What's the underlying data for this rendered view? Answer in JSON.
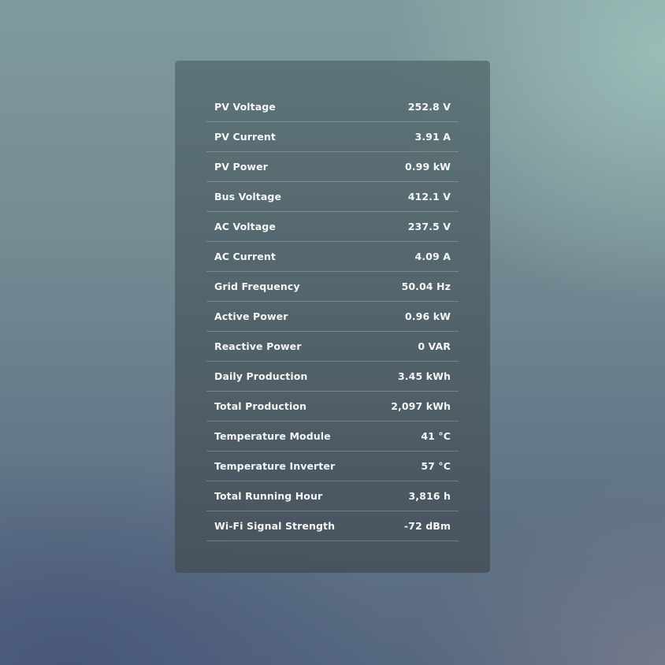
{
  "readings": [
    {
      "label": "PV Voltage",
      "value": "252.8 V"
    },
    {
      "label": "PV Current",
      "value": "3.91 A"
    },
    {
      "label": "PV Power",
      "value": "0.99 kW"
    },
    {
      "label": "Bus Voltage",
      "value": "412.1 V"
    },
    {
      "label": "AC Voltage",
      "value": "237.5 V"
    },
    {
      "label": "AC Current",
      "value": "4.09 A"
    },
    {
      "label": "Grid Frequency",
      "value": "50.04 Hz"
    },
    {
      "label": "Active Power",
      "value": "0.96 kW"
    },
    {
      "label": "Reactive Power",
      "value": "0 VAR"
    },
    {
      "label": "Daily Production",
      "value": "3.45 kWh"
    },
    {
      "label": "Total Production",
      "value": "2,097 kWh"
    },
    {
      "label": "Temperature Module",
      "value": "41 °C"
    },
    {
      "label": "Temperature Inverter",
      "value": "57 °C"
    },
    {
      "label": "Total Running Hour",
      "value": "3,816 h"
    },
    {
      "label": "Wi-Fi Signal Strength",
      "value": "-72 dBm"
    }
  ]
}
